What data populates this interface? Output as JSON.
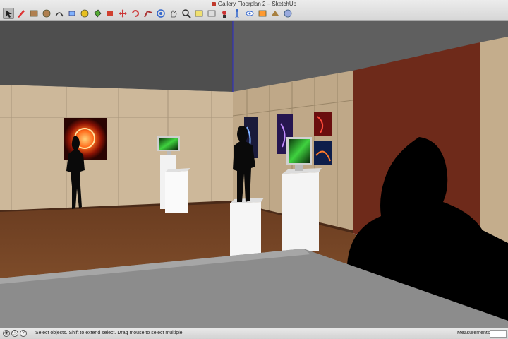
{
  "window": {
    "title": "Gallery Floorplan 2 – SketchUp"
  },
  "toolbar": {
    "tools": [
      {
        "name": "select-tool-icon",
        "active": true
      },
      {
        "name": "pencil-tool-icon"
      },
      {
        "name": "rectangle-tool-icon"
      },
      {
        "name": "circle-tool-icon"
      },
      {
        "name": "arc-tool-icon"
      },
      {
        "name": "eraser-tool-icon"
      },
      {
        "name": "tape-measure-tool-icon"
      },
      {
        "name": "paint-bucket-tool-icon"
      },
      {
        "name": "push-pull-tool-icon"
      },
      {
        "name": "move-tool-icon"
      },
      {
        "name": "rotate-tool-icon"
      },
      {
        "name": "follow-me-tool-icon"
      },
      {
        "name": "orbit-tool-icon"
      },
      {
        "name": "pan-tool-icon"
      },
      {
        "name": "zoom-tool-icon"
      },
      {
        "name": "zoom-extents-tool-icon"
      },
      {
        "name": "previous-view-tool-icon"
      },
      {
        "name": "position-camera-tool-icon"
      },
      {
        "name": "walk-tool-icon"
      },
      {
        "name": "look-around-tool-icon"
      },
      {
        "name": "section-plane-tool-icon"
      },
      {
        "name": "add-location-tool-icon"
      },
      {
        "name": "warehouse-tool-icon"
      }
    ]
  },
  "status": {
    "message": "Select objects. Shift to extend select. Drag mouse to select multiple.",
    "measurements_label": "Measurements",
    "measurements_value": ""
  },
  "colors": {
    "wall": "#cdb89a",
    "floor": "#7a4a2a",
    "accent_wall": "#6e2a1a",
    "ceiling": "#5f5f5f",
    "plinth": "#f2f2f2",
    "foreground_platform": "#8c8c8c"
  }
}
